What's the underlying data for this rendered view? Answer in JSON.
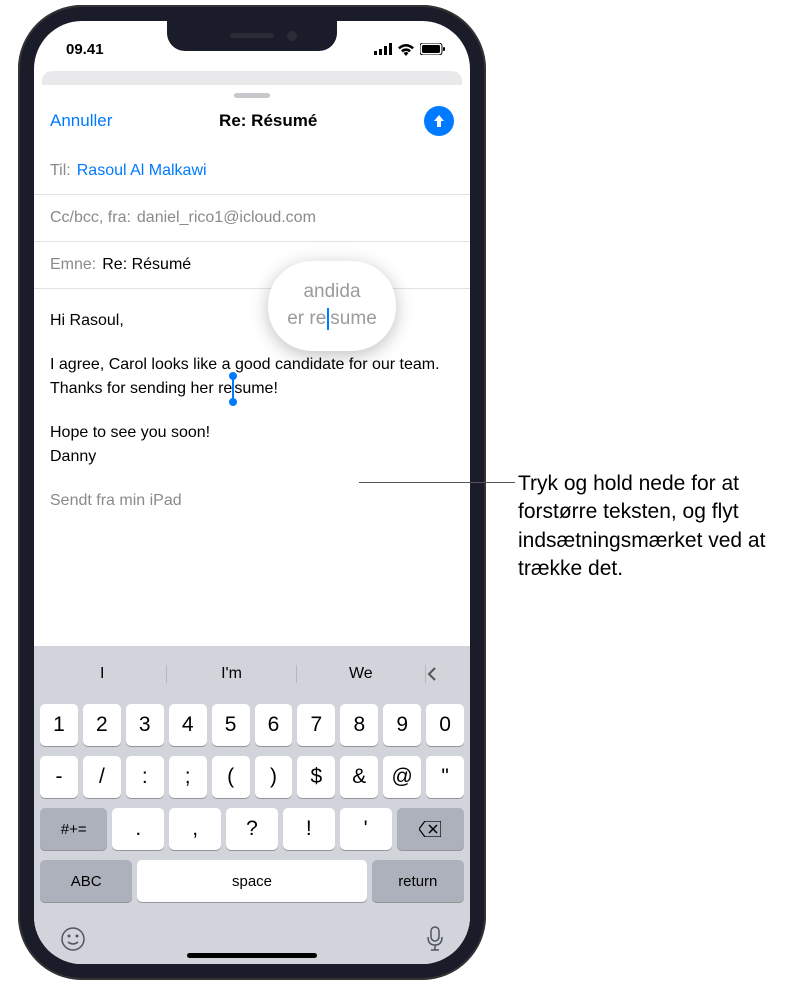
{
  "status": {
    "time": "09.41"
  },
  "nav": {
    "cancel": "Annuller",
    "title": "Re: Résumé"
  },
  "fields": {
    "to_label": "Til:",
    "to_value": "Rasoul Al Malkawi",
    "ccbcc_label": "Cc/bcc, fra:",
    "ccbcc_value": "daniel_rico1@icloud.com",
    "subject_label": "Emne:",
    "subject_value": "Re: Résumé"
  },
  "body": {
    "greeting": "Hi Rasoul,",
    "para_a": "I agree, Carol looks like a good candidate for our team. Thanks for sending her re",
    "para_b": "sume!",
    "closing1": "Hope to see you soon!",
    "closing2": "Danny",
    "footer_cut": "Sendt fra min iPad"
  },
  "magnifier": {
    "l1": "andida",
    "l2a": "er re",
    "l2b": "sume"
  },
  "suggestions": {
    "s1": "I",
    "s2": "I'm",
    "s3": "We"
  },
  "keys": {
    "r1": [
      "1",
      "2",
      "3",
      "4",
      "5",
      "6",
      "7",
      "8",
      "9",
      "0"
    ],
    "r2": [
      "-",
      "/",
      ":",
      ";",
      "(",
      ")",
      "$",
      "&",
      "@",
      "\""
    ],
    "r3": [
      ".",
      ",",
      "?",
      "!",
      "'"
    ],
    "shift": "#+=",
    "abc": "ABC",
    "space": "space",
    "return": "return"
  },
  "callout": "Tryk og hold nede for at forstørre teksten, og flyt indsætningsmærket ved at trække det."
}
